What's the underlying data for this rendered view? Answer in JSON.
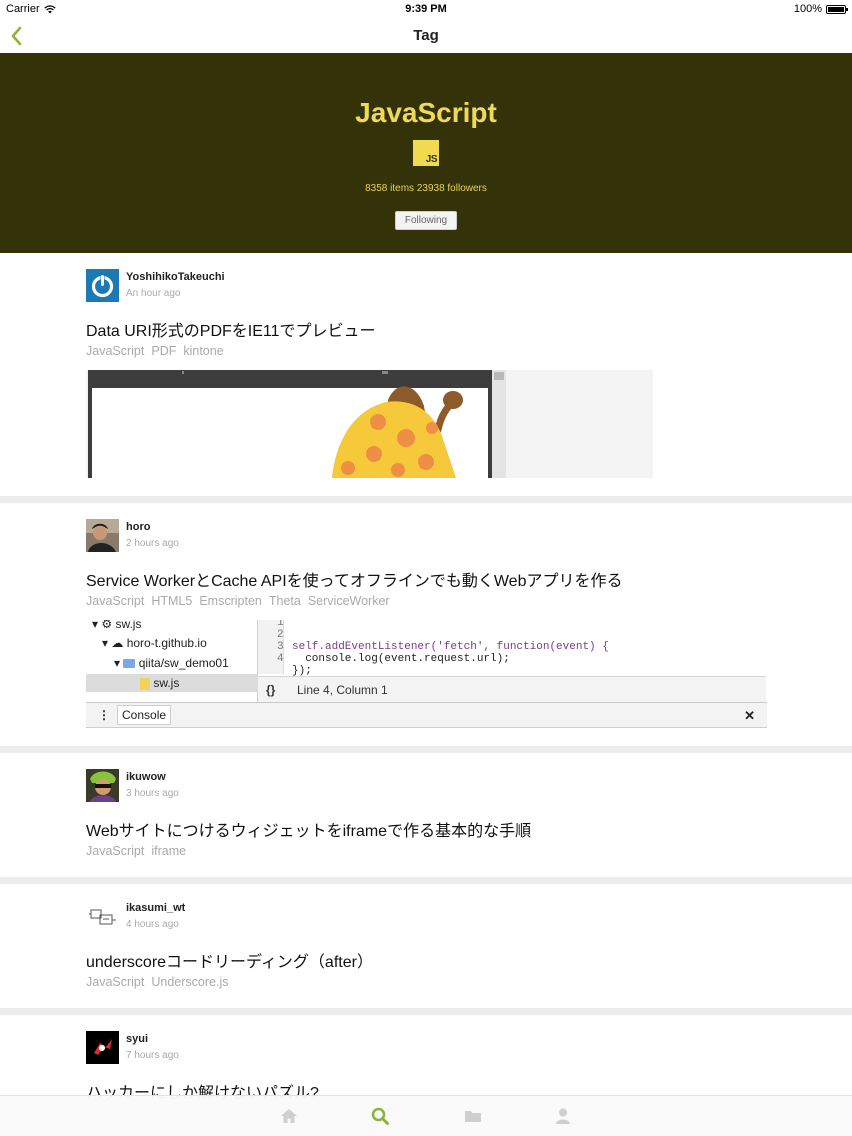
{
  "status_bar": {
    "carrier": "Carrier",
    "time": "9:39 PM",
    "battery": "100%"
  },
  "nav": {
    "title": "Tag"
  },
  "tag": {
    "name": "JavaScript",
    "logo_text": "JS",
    "stats": "8358 items  23938 followers",
    "follow_label": "Following"
  },
  "colors": {
    "accent": "#8fb23a",
    "header_bg": "#333209",
    "tag_yellow": "#efd957"
  },
  "items": [
    {
      "author": "YoshihikoTakeuchi",
      "ago": "An hour ago",
      "title": "Data URI形式のPDFをIE11でプレビュー",
      "tags": [
        "JavaScript",
        "PDF",
        "kintone"
      ]
    },
    {
      "author": "horo",
      "ago": "2 hours ago",
      "title": "Service WorkerとCache APIを使ってオフラインでも動くWebアプリを作る",
      "tags": [
        "JavaScript",
        "HTML5",
        "Emscripten",
        "Theta",
        "ServiceWorker"
      ]
    },
    {
      "author": "ikuwow",
      "ago": "3 hours ago",
      "title": "Webサイトにつけるウィジェットをiframeで作る基本的な手順",
      "tags": [
        "JavaScript",
        "iframe"
      ]
    },
    {
      "author": "ikasumi_wt",
      "ago": "4 hours ago",
      "title": "underscoreコードリーディング（after）",
      "tags": [
        "JavaScript",
        "Underscore.js"
      ]
    },
    {
      "author": "syui",
      "ago": "7 hours ago",
      "title": "ハッカーにしか解けないパズル?",
      "tags": []
    }
  ],
  "devtools": {
    "tree": [
      "sw.js",
      "horo-t.github.io",
      "qiita/sw_demo01",
      "sw.js"
    ],
    "line_numbers": [
      "1",
      "2",
      "3",
      "4"
    ],
    "code": [
      "self.addEventListener('fetch', function(event) {",
      "  console.log(event.request.url);",
      "});",
      ""
    ],
    "status": "Line 4, Column 1",
    "braces": "{}",
    "console_tab": "Console",
    "close": "✕"
  },
  "tabs": {
    "home": "home-icon",
    "search": "search-icon",
    "folder": "folder-icon",
    "profile": "person-icon"
  }
}
